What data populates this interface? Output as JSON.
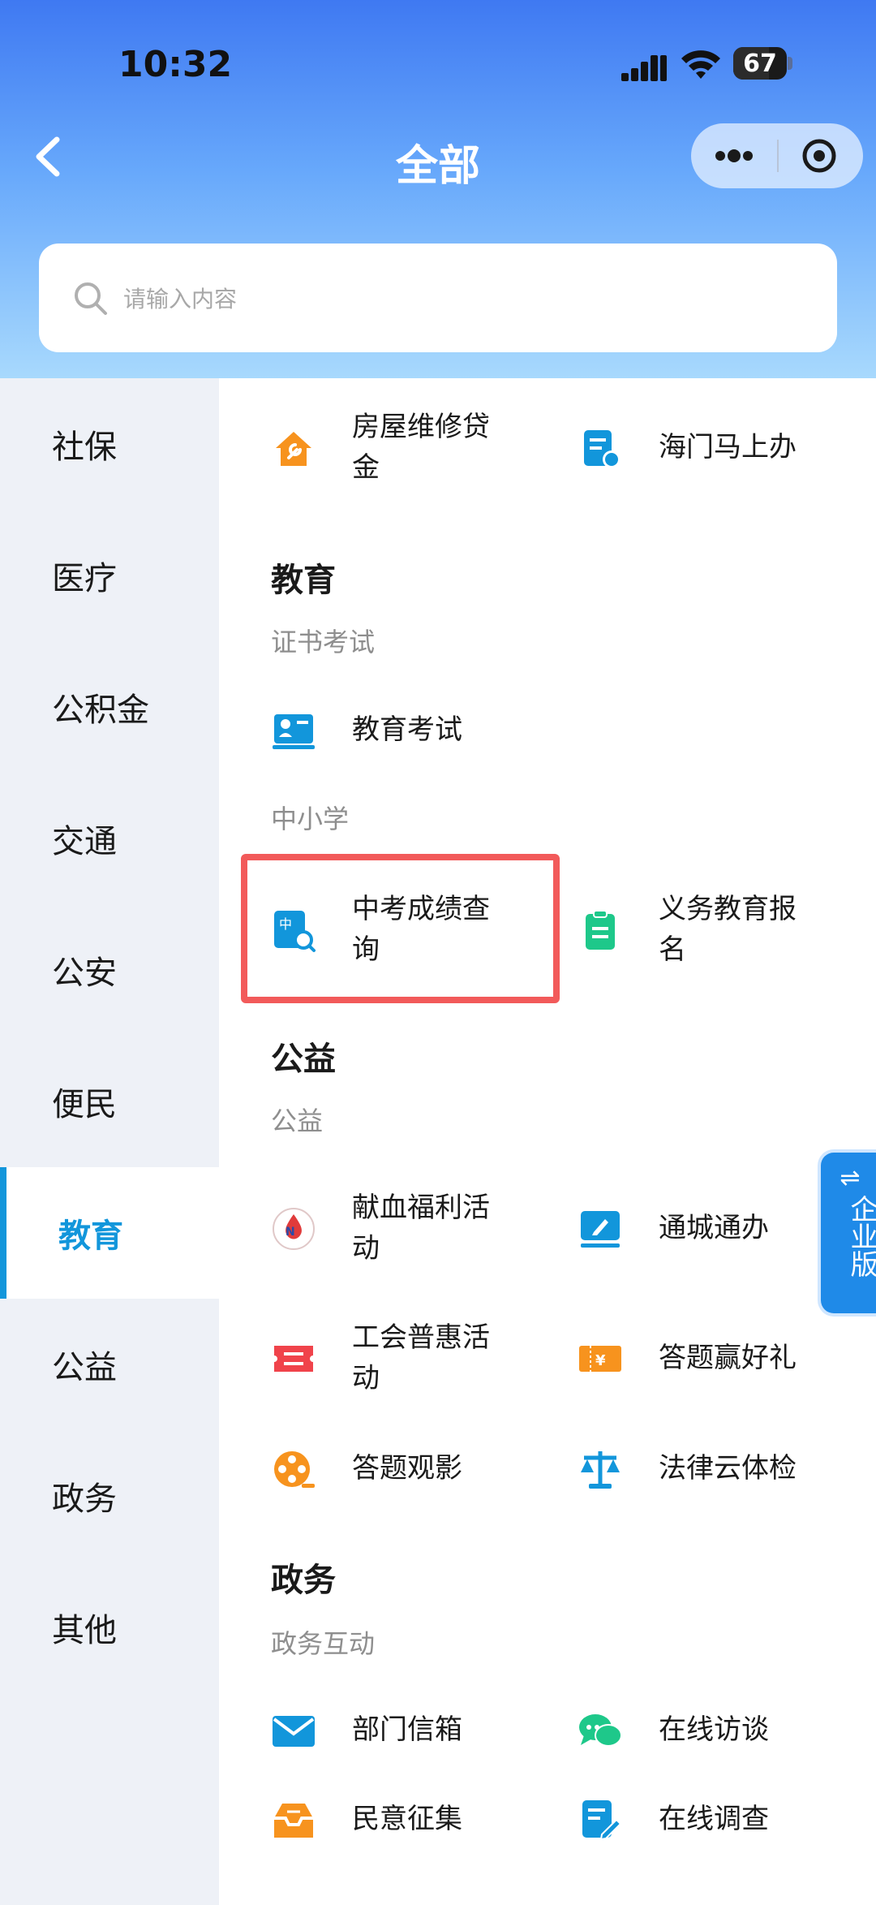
{
  "status_bar": {
    "time": "10:32",
    "battery_percent": "67",
    "battery_level": 0.67
  },
  "header": {
    "title": "全部"
  },
  "search": {
    "placeholder": "请输入内容"
  },
  "sidebar": {
    "items": [
      {
        "label": "社保",
        "active": false
      },
      {
        "label": "医疗",
        "active": false
      },
      {
        "label": "公积金",
        "active": false
      },
      {
        "label": "交通",
        "active": false
      },
      {
        "label": "公安",
        "active": false
      },
      {
        "label": "便民",
        "active": false
      },
      {
        "label": "教育",
        "active": true
      },
      {
        "label": "公益",
        "active": false
      },
      {
        "label": "政务",
        "active": false
      },
      {
        "label": "其他",
        "active": false
      }
    ]
  },
  "content": {
    "top_items": [
      {
        "label": "房屋维修贷\n金",
        "icon": "house-wrench-icon",
        "color": "#f7931e"
      },
      {
        "label": "海门马上办",
        "icon": "form-clock-icon",
        "color": "#1296db"
      }
    ],
    "education": {
      "title": "教育",
      "sub1": "证书考试",
      "exam": {
        "label": "教育考试",
        "icon": "exam-icon",
        "color": "#1296db"
      },
      "sub2": "中小学",
      "score": {
        "label": "中考成绩查\n询",
        "icon": "score-search-icon",
        "color": "#1296db"
      },
      "enroll": {
        "label": "义务教育报\n名",
        "icon": "clipboard-icon",
        "color": "#1ec88a"
      }
    },
    "charity": {
      "title": "公益",
      "sub": "公益",
      "items": [
        {
          "label": "献血福利活\n动",
          "icon": "blood-donation-icon",
          "color": "#e03b3b"
        },
        {
          "label": "通城通办",
          "icon": "edit-screen-icon",
          "color": "#1296db"
        },
        {
          "label": "工会普惠活\n动",
          "icon": "ticket-icon",
          "color": "#f0434b"
        },
        {
          "label": "答题赢好礼",
          "icon": "voucher-icon",
          "color": "#f7931e"
        },
        {
          "label": "答题观影",
          "icon": "film-reel-icon",
          "color": "#f7931e"
        },
        {
          "label": "法律云体检",
          "icon": "scales-icon",
          "color": "#1296db"
        }
      ]
    },
    "government": {
      "title": "政务",
      "sub": "政务互动",
      "items": [
        {
          "label": "部门信箱",
          "icon": "mail-icon",
          "color": "#1296db"
        },
        {
          "label": "在线访谈",
          "icon": "chat-icon",
          "color": "#1ec88a"
        },
        {
          "label": "民意征集",
          "icon": "inbox-icon",
          "color": "#f7931e"
        },
        {
          "label": "在线调查",
          "icon": "survey-icon",
          "color": "#1296db"
        }
      ]
    }
  },
  "enterprise_tab": {
    "swap_symbol": "⇌",
    "label": "企业版"
  }
}
